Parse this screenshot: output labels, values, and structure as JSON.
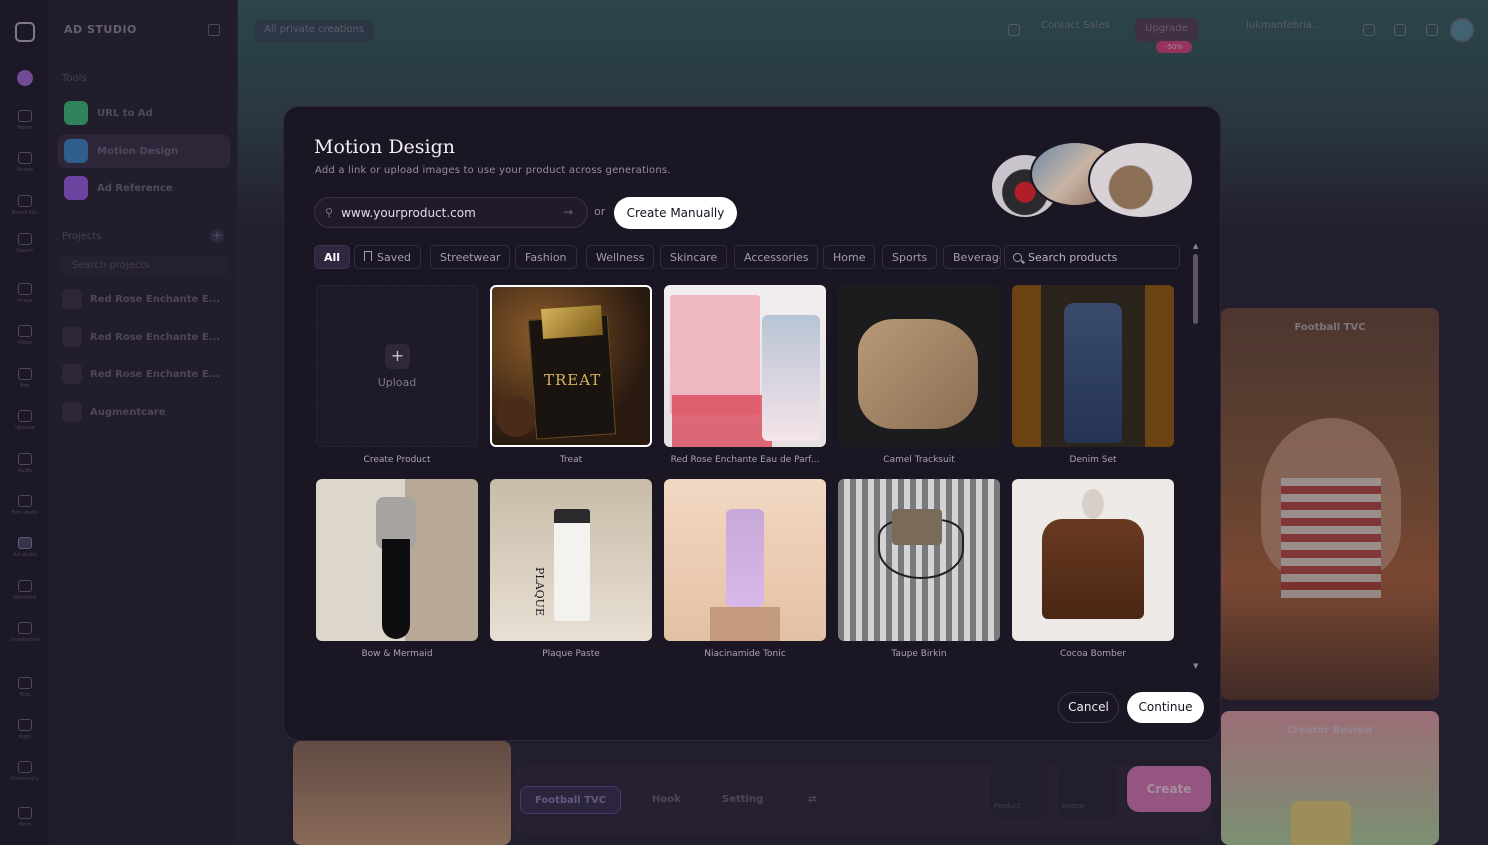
{
  "app": {
    "brand": "AD STUDIO"
  },
  "rail": {
    "items": [
      {
        "label": "Home",
        "icon": "home-icon"
      },
      {
        "label": "Assets",
        "icon": "assets-icon"
      },
      {
        "label": "Brand Kits",
        "icon": "brand-kit-icon"
      },
      {
        "label": "Search",
        "icon": "search-icon"
      },
      {
        "label": "Image",
        "icon": "image-icon"
      },
      {
        "label": "Video",
        "icon": "video-icon"
      },
      {
        "label": "Box",
        "icon": "box-icon"
      },
      {
        "label": "Upscale",
        "icon": "upscale-icon"
      },
      {
        "label": "Audio",
        "icon": "audio-icon"
      },
      {
        "label": "Film studio",
        "icon": "film-icon"
      },
      {
        "label": "Ad studio",
        "icon": "ad-studio-icon"
      },
      {
        "label": "Workflow",
        "icon": "workflow-icon"
      },
      {
        "label": "Imagination",
        "icon": "imagination-icon"
      },
      {
        "label": "Tools",
        "icon": "tools-icon"
      },
      {
        "label": "Apps",
        "icon": "apps-icon"
      },
      {
        "label": "Community",
        "icon": "community-icon"
      },
      {
        "label": "More",
        "icon": "more-icon"
      }
    ]
  },
  "sidebar": {
    "tools_heading": "Tools",
    "tools": [
      {
        "label": "URL to Ad",
        "color": "#3fbf7f"
      },
      {
        "label": "Motion Design",
        "color": "#3c87c9"
      },
      {
        "label": "Ad Reference",
        "color": "#9b5de5"
      }
    ],
    "projects_heading": "Projects",
    "search_placeholder": "Search projects",
    "projects": [
      "Red Rose Enchante E...",
      "Red Rose Enchante E...",
      "Red Rose Enchante E...",
      "Augmentcare"
    ]
  },
  "topnav": {
    "filter": "All private creations",
    "contact": "Contact Sales",
    "upgrade": "Upgrade",
    "upgrade_badge": "-50%",
    "user": "lukmanfebria..."
  },
  "background": {
    "promo1": "Football TVC",
    "promo2": "Creator Review",
    "composer": {
      "chip_selected": "Football TVC",
      "chip_hook": "Hook",
      "chip_setting": "Setting",
      "slot1": "Product",
      "slot2": "Avatar",
      "create": "Create"
    }
  },
  "modal": {
    "title": "Motion Design",
    "subtitle": "Add a link or upload images to use your product across generations.",
    "url_value": "www.yourproduct.com",
    "or_text": "or",
    "create_manually": "Create Manually",
    "categories": [
      "All",
      "Saved",
      "Streetwear",
      "Fashion",
      "Wellness",
      "Skincare",
      "Accessories",
      "Home",
      "Sports",
      "Beverages"
    ],
    "search_placeholder": "Search products",
    "upload_label": "Upload",
    "create_product_label": "Create Product",
    "products": [
      "Treat",
      "Red Rose Enchante Eau de Parf...",
      "Camel Tracksuit",
      "Denim Set",
      "Bow & Mermaid",
      "Plaque Paste",
      "Niacinamide Tonic",
      "Taupe Birkin",
      "Cocoa Bomber"
    ],
    "treat_package_text": "TREAT",
    "plaque_tube_text": "PLAQUE",
    "cancel": "Cancel",
    "continue": "Continue"
  }
}
